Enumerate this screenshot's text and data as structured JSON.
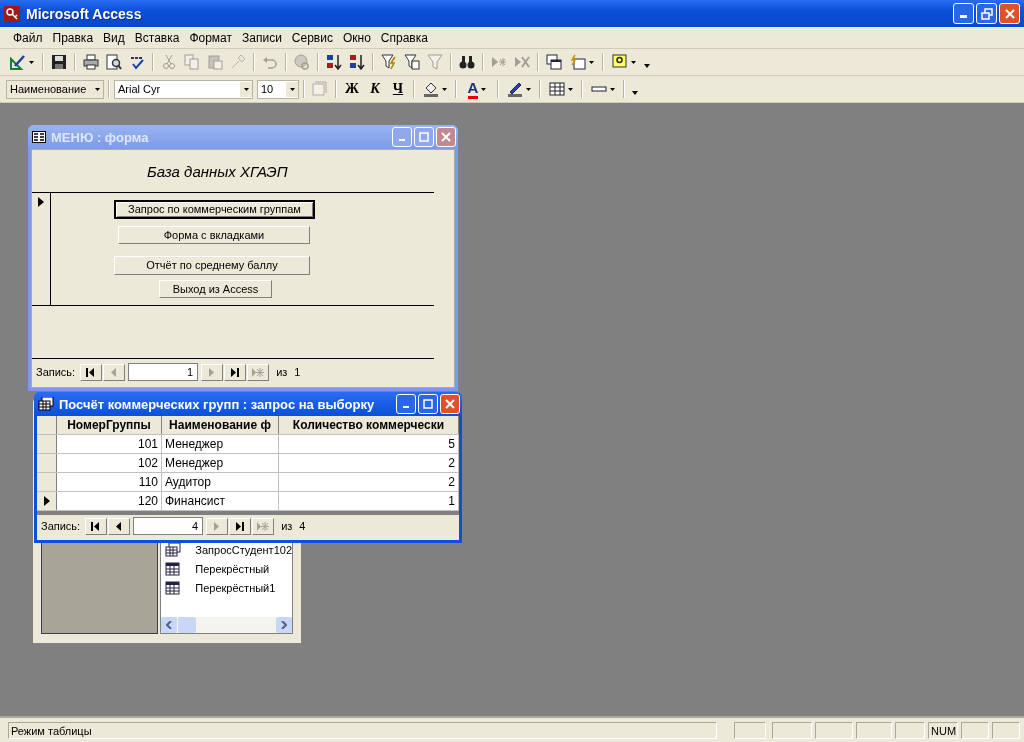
{
  "app": {
    "title": "Microsoft Access"
  },
  "menu": [
    "Файл",
    "Правка",
    "Вид",
    "Вставка",
    "Формат",
    "Записи",
    "Сервис",
    "Окно",
    "Справка"
  ],
  "toolbar": [
    {
      "kind": "design",
      "disabled": false,
      "dropdown": true
    },
    {
      "kind": "sep"
    },
    {
      "kind": "save",
      "disabled": false,
      "dropdown": false
    },
    {
      "kind": "sep"
    },
    {
      "kind": "print",
      "disabled": false,
      "dropdown": false
    },
    {
      "kind": "preview",
      "disabled": false,
      "dropdown": false
    },
    {
      "kind": "spelling",
      "disabled": false,
      "dropdown": false
    },
    {
      "kind": "sep"
    },
    {
      "kind": "cut",
      "disabled": true,
      "dropdown": false
    },
    {
      "kind": "copy",
      "disabled": true,
      "dropdown": false
    },
    {
      "kind": "paste",
      "disabled": true,
      "dropdown": false
    },
    {
      "kind": "brush",
      "disabled": true,
      "dropdown": false
    },
    {
      "kind": "sep"
    },
    {
      "kind": "undo",
      "disabled": true,
      "dropdown": false
    },
    {
      "kind": "sep"
    },
    {
      "kind": "globe",
      "disabled": true,
      "dropdown": false
    },
    {
      "kind": "sep"
    },
    {
      "kind": "sort-asc",
      "disabled": false,
      "dropdown": false
    },
    {
      "kind": "sort-desc",
      "disabled": false,
      "dropdown": false
    },
    {
      "kind": "sep"
    },
    {
      "kind": "filter-selection",
      "disabled": false,
      "dropdown": false
    },
    {
      "kind": "filter-form",
      "disabled": false,
      "dropdown": false
    },
    {
      "kind": "filter",
      "disabled": true,
      "dropdown": false
    },
    {
      "kind": "sep"
    },
    {
      "kind": "find",
      "disabled": false,
      "dropdown": false
    },
    {
      "kind": "sep"
    },
    {
      "kind": "new-record",
      "disabled": true,
      "dropdown": false
    },
    {
      "kind": "delete-record",
      "disabled": true,
      "dropdown": false
    },
    {
      "kind": "sep"
    },
    {
      "kind": "windows",
      "disabled": false,
      "dropdown": false
    },
    {
      "kind": "new-object",
      "disabled": false,
      "dropdown": true
    },
    {
      "kind": "sep"
    },
    {
      "kind": "help",
      "disabled": false,
      "dropdown": true
    }
  ],
  "format_toolbar": {
    "style": "Наименование",
    "font": "Arial Cyr",
    "size": "10",
    "buttons": [
      {
        "kind": "effect",
        "disabled": true,
        "dropdown": false
      },
      {
        "kind": "bold",
        "label": "Ж",
        "disabled": false,
        "dropdown": false
      },
      {
        "kind": "italic",
        "label": "К",
        "disabled": false,
        "dropdown": false
      },
      {
        "kind": "underline",
        "label": "Ч",
        "disabled": false,
        "dropdown": false
      },
      {
        "kind": "fill-color",
        "disabled": false,
        "dropdown": true
      },
      {
        "kind": "font-color",
        "label": "A",
        "disabled": false,
        "dropdown": true
      },
      {
        "kind": "line-color",
        "disabled": false,
        "dropdown": true
      },
      {
        "kind": "gridlines",
        "disabled": false,
        "dropdown": true
      },
      {
        "kind": "border",
        "disabled": false,
        "dropdown": true
      }
    ]
  },
  "form_window": {
    "title": "МЕНЮ : форма",
    "active": false,
    "heading": "База данных ХГАЭП",
    "buttons": [
      {
        "label": "Запрос по коммерческим группам",
        "focused": true
      },
      {
        "label": "Форма с вкладками",
        "focused": false
      },
      {
        "label": "Отчёт по среднему баллу",
        "focused": false
      },
      {
        "label": "Выход из Access",
        "focused": false
      }
    ],
    "navigator": {
      "label": "Запись:",
      "current": "1",
      "of": "из",
      "total": "1",
      "buttons": [
        {
          "kind": "first",
          "disabled": false
        },
        {
          "kind": "prev",
          "disabled": true
        },
        {
          "kind": "next",
          "disabled": true
        },
        {
          "kind": "last",
          "disabled": false
        },
        {
          "kind": "new",
          "disabled": true
        }
      ]
    }
  },
  "database_window": {
    "items": [
      {
        "label": "ЗапросСтудент102",
        "kind": "query"
      },
      {
        "label": "Перекрёстный",
        "kind": "crosstab"
      },
      {
        "label": "Перекрёстный1",
        "kind": "crosstab"
      }
    ]
  },
  "query_window": {
    "title": "Посчёт коммерческих групп : запрос на выборку",
    "active": true,
    "columns": [
      "НомерГруппы",
      "Наименование ф",
      "Количество коммерчески"
    ],
    "rows": [
      {
        "cells": [
          "101",
          "Менеджер",
          "5"
        ],
        "current": false
      },
      {
        "cells": [
          "102",
          "Менеджер",
          "2"
        ],
        "current": false
      },
      {
        "cells": [
          "110",
          "Аудитор",
          "2"
        ],
        "current": false
      },
      {
        "cells": [
          "120",
          "Финансист",
          "1"
        ],
        "current": true
      }
    ],
    "navigator": {
      "label": "Запись:",
      "current": "4",
      "of": "из",
      "total": "4",
      "buttons": [
        {
          "kind": "first",
          "disabled": false
        },
        {
          "kind": "prev",
          "disabled": false
        },
        {
          "kind": "next",
          "disabled": true
        },
        {
          "kind": "last",
          "disabled": false
        },
        {
          "kind": "new",
          "disabled": true
        }
      ]
    }
  },
  "status_bar": {
    "text": "Режим таблицы",
    "num": "NUM"
  }
}
